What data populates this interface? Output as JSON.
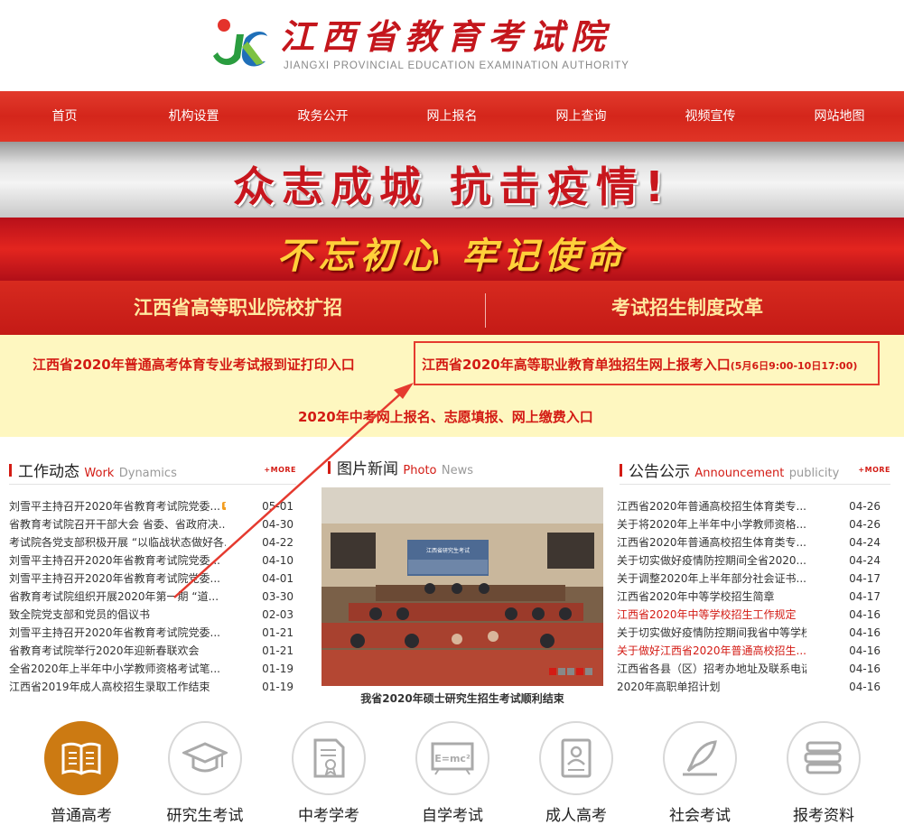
{
  "header": {
    "title": "江西省教育考试院",
    "subtitle": "JIANGXI PROVINCIAL EDUCATION EXAMINATION AUTHORITY",
    "logo_icon": "jx-logo-icon"
  },
  "nav": {
    "items": [
      "首页",
      "机构设置",
      "政务公开",
      "网上报名",
      "网上查询",
      "视频宣传",
      "网站地图"
    ]
  },
  "banners": {
    "slogan1": "众志成城 抗击疫情!",
    "slogan2": "不忘初心 牢记使命",
    "link_left": "江西省高等职业院校扩招",
    "link_right": "考试招生制度改革"
  },
  "quick_links": {
    "link1": "江西省2020年普通高考体育专业考试报到证打印入口",
    "link2": "江西省2020年高等职业教育单独招生网上报考入口",
    "link2_time": "(5月6日9:00-10日17:00)",
    "link3": "2020年中考网上报名、志愿填报、网上缴费入口"
  },
  "work": {
    "title": "工作动态",
    "en1": "Work",
    "en2": "Dynamics",
    "more": "+MORE",
    "new_label": "NEW",
    "items": [
      {
        "text": "刘雪平主持召开2020年省教育考试院党委...",
        "date": "05-01",
        "new": true
      },
      {
        "text": "省教育考试院召开干部大会 省委、省政府决...",
        "date": "04-30",
        "new": true
      },
      {
        "text": "考试院各党支部积极开展 “以临战状态做好各...",
        "date": "04-22"
      },
      {
        "text": "刘雪平主持召开2020年省教育考试院党委...",
        "date": "04-10"
      },
      {
        "text": "刘雪平主持召开2020年省教育考试院党委...",
        "date": "04-01"
      },
      {
        "text": "省教育考试院组织开展2020年第一期 “道...",
        "date": "03-30"
      },
      {
        "text": "致全院党支部和党员的倡议书",
        "date": "02-03"
      },
      {
        "text": "刘雪平主持召开2020年省教育考试院党委...",
        "date": "01-21"
      },
      {
        "text": "省教育考试院举行2020年迎新春联欢会",
        "date": "01-21"
      },
      {
        "text": "全省2020年上半年中小学教师资格考试笔...",
        "date": "01-19"
      },
      {
        "text": "江西省2019年成人高校招生录取工作结束",
        "date": "01-19"
      }
    ]
  },
  "photo_news": {
    "title": "图片新闻",
    "en1": "Photo",
    "en2": "News",
    "caption": "我省2020年硕士研究生招生考试顺利结束",
    "screen_text": "江西省研究生考试"
  },
  "notice": {
    "title": "公告公示",
    "en1": "Announcement",
    "en2": "publicity",
    "more": "+MORE",
    "items": [
      {
        "text": "江西省2020年普通高校招生体育类专...",
        "date": "04-26"
      },
      {
        "text": "关于将2020年上半年中小学教师资格...",
        "date": "04-26"
      },
      {
        "text": "江西省2020年普通高校招生体育类专...",
        "date": "04-24"
      },
      {
        "text": "关于切实做好疫情防控期间全省2020...",
        "date": "04-24"
      },
      {
        "text": "关于调整2020年上半年部分社会证书...",
        "date": "04-17"
      },
      {
        "text": "江西省2020年中等学校招生简章",
        "date": "04-17"
      },
      {
        "text": "江西省2020年中等学校招生工作规定",
        "date": "04-16",
        "red": true
      },
      {
        "text": "关于切实做好疫情防控期间我省中等学校...",
        "date": "04-16"
      },
      {
        "text": "关于做好江西省2020年普通高校招生...",
        "date": "04-16",
        "red": true
      },
      {
        "text": "江西省各县（区）招考办地址及联系电话...",
        "date": "04-16"
      },
      {
        "text": "2020年高职单招计划",
        "date": "04-16"
      }
    ]
  },
  "bottom_icons": [
    {
      "label": "普通高考",
      "icon": "book-icon"
    },
    {
      "label": "研究生考试",
      "icon": "graduation-cap-icon"
    },
    {
      "label": "中考学考",
      "icon": "certificate-document-icon"
    },
    {
      "label": "自学考试",
      "icon": "formula-board-icon"
    },
    {
      "label": "成人高考",
      "icon": "id-document-icon"
    },
    {
      "label": "社会考试",
      "icon": "quill-pen-icon"
    },
    {
      "label": "报考资料",
      "icon": "stacked-books-icon"
    }
  ],
  "colors": {
    "brand_red": "#d31b14",
    "nav_red": "#e03426",
    "highlight_yellow": "#fef7c0",
    "active_icon": "#cc7a12"
  }
}
